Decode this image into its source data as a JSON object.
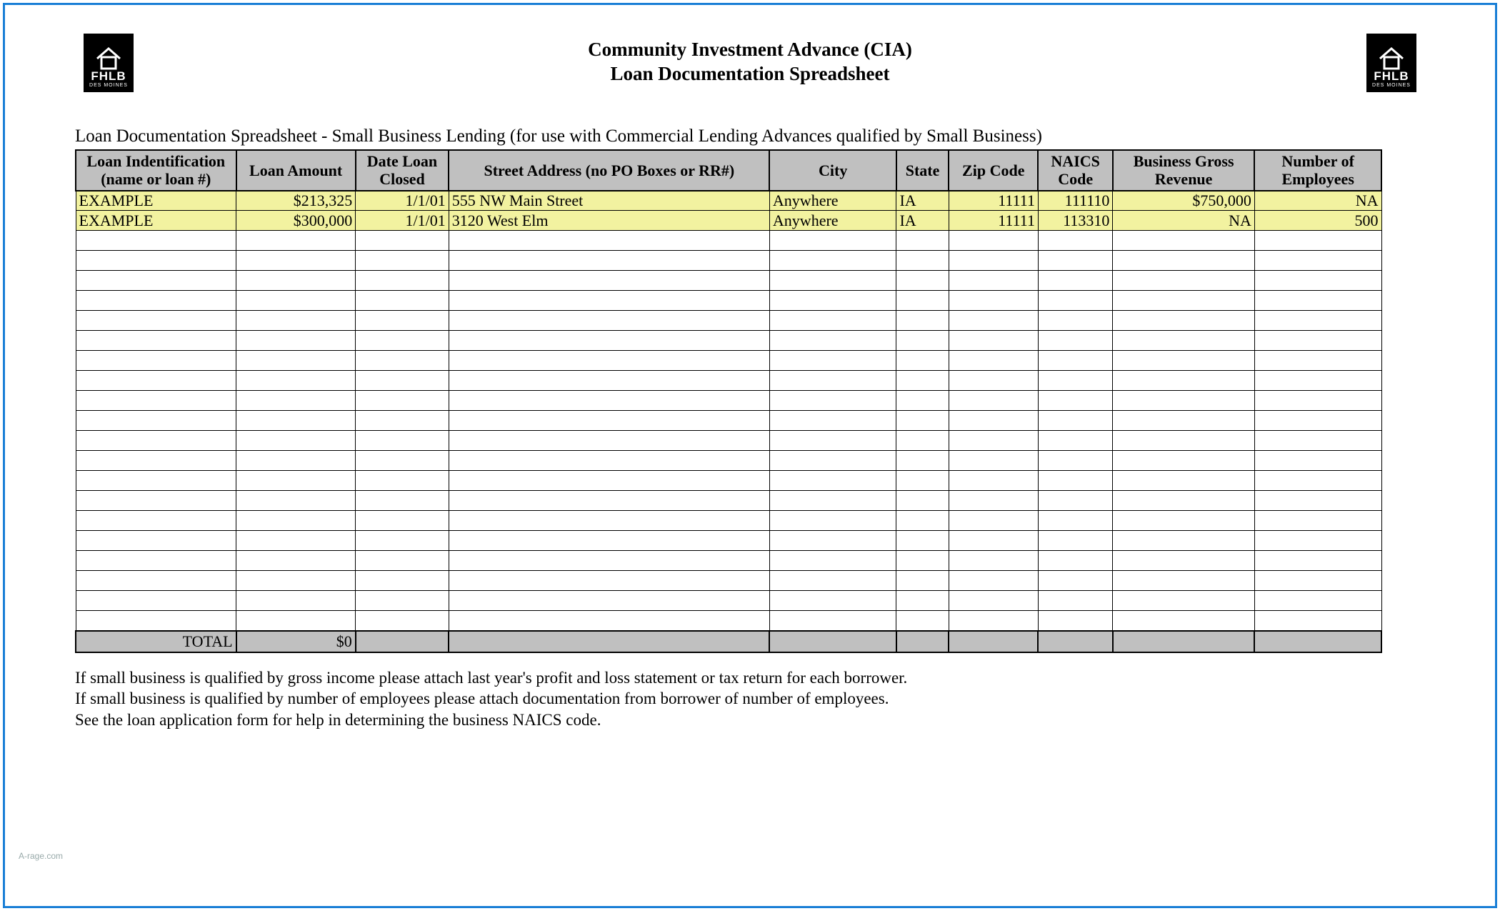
{
  "header": {
    "title_line1": "Community Investment Advance (CIA)",
    "title_line2": "Loan Documentation Spreadsheet",
    "logo_text": "FHLB",
    "logo_sub": "DES MOINES"
  },
  "subtitle": "Loan Documentation Spreadsheet - Small Business Lending (for use with Commercial Lending Advances qualified by Small Business)",
  "columns": [
    "Loan Indentification (name or loan #)",
    "Loan Amount",
    "Date Loan Closed",
    "Street Address (no PO Boxes or RR#)",
    "City",
    "State",
    "Zip Code",
    "NAICS Code",
    "Business Gross Revenue",
    "Number of Employees"
  ],
  "rows": [
    {
      "id": "EXAMPLE",
      "amount": "$213,325",
      "date": "1/1/01",
      "street": "555 NW Main Street",
      "city": "Anywhere",
      "state": "IA",
      "zip": "11111",
      "naics": "111110",
      "revenue": "$750,000",
      "employees": "NA"
    },
    {
      "id": "EXAMPLE",
      "amount": "$300,000",
      "date": "1/1/01",
      "street": "3120 West Elm",
      "city": "Anywhere",
      "state": "IA",
      "zip": "11111",
      "naics": "113310",
      "revenue": "NA",
      "employees": "500"
    }
  ],
  "empty_row_count": 20,
  "total": {
    "label": "TOTAL",
    "amount": "$0"
  },
  "notes": [
    "If small business is qualified by gross income please attach last year's profit and loss statement or tax return for each borrower.",
    "If small business is qualified by number of employees please attach documentation from borrower of number of employees.",
    "See the loan application form for help in determining the business NAICS code."
  ],
  "watermark": "A-rage.com"
}
